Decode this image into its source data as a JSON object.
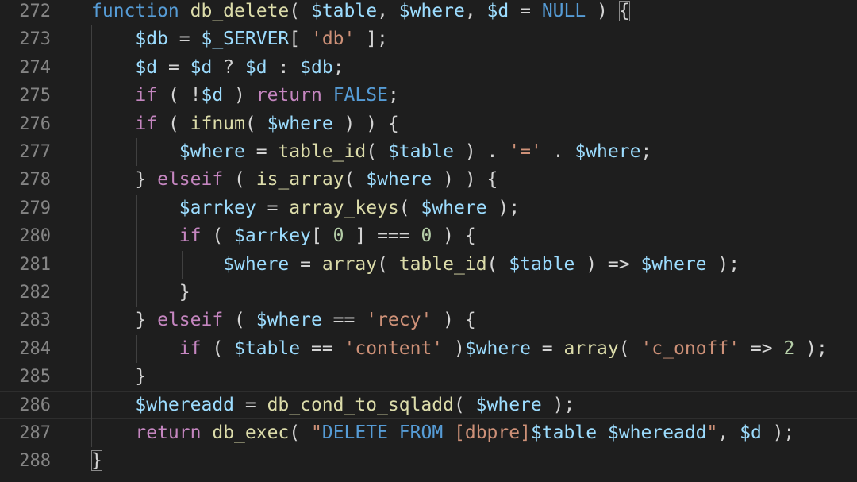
{
  "editor": {
    "language": "php",
    "colors": {
      "background": "#1e1e1e",
      "line_number": "#858585",
      "keyword": "#569cd6",
      "control": "#c586c0",
      "function": "#dcdcaa",
      "variable": "#9cdcfe",
      "string": "#ce9178",
      "number": "#b5cea8"
    },
    "lines": [
      {
        "number": "272",
        "tokens": [
          {
            "t": "function",
            "c": "k-fn"
          },
          {
            "t": " "
          },
          {
            "t": "db_delete",
            "c": "fn"
          },
          {
            "t": "( "
          },
          {
            "t": "$table",
            "c": "v"
          },
          {
            "t": ", "
          },
          {
            "t": "$where",
            "c": "v"
          },
          {
            "t": ", "
          },
          {
            "t": "$d",
            "c": "v"
          },
          {
            "t": " = "
          },
          {
            "t": "NULL",
            "c": "c"
          },
          {
            "t": " ) "
          },
          {
            "t": "{",
            "c": "bracket-hl"
          }
        ]
      },
      {
        "number": "273",
        "tokens": [
          {
            "t": "    "
          },
          {
            "t": "$db",
            "c": "v"
          },
          {
            "t": " = "
          },
          {
            "t": "$_SERVER",
            "c": "v"
          },
          {
            "t": "[ "
          },
          {
            "t": "'db'",
            "c": "s"
          },
          {
            "t": " ];"
          }
        ]
      },
      {
        "number": "274",
        "tokens": [
          {
            "t": "    "
          },
          {
            "t": "$d",
            "c": "v"
          },
          {
            "t": " = "
          },
          {
            "t": "$d",
            "c": "v"
          },
          {
            "t": " ? "
          },
          {
            "t": "$d",
            "c": "v"
          },
          {
            "t": " : "
          },
          {
            "t": "$db",
            "c": "v"
          },
          {
            "t": ";"
          }
        ]
      },
      {
        "number": "275",
        "tokens": [
          {
            "t": "    "
          },
          {
            "t": "if",
            "c": "k-ctl"
          },
          {
            "t": " ( !"
          },
          {
            "t": "$d",
            "c": "v"
          },
          {
            "t": " ) "
          },
          {
            "t": "return",
            "c": "k-ctl"
          },
          {
            "t": " "
          },
          {
            "t": "FALSE",
            "c": "c"
          },
          {
            "t": ";"
          }
        ]
      },
      {
        "number": "276",
        "tokens": [
          {
            "t": "    "
          },
          {
            "t": "if",
            "c": "k-ctl"
          },
          {
            "t": " ( "
          },
          {
            "t": "ifnum",
            "c": "fn"
          },
          {
            "t": "( "
          },
          {
            "t": "$where",
            "c": "v"
          },
          {
            "t": " ) ) {"
          }
        ]
      },
      {
        "number": "277",
        "tokens": [
          {
            "t": "        "
          },
          {
            "t": "$where",
            "c": "v"
          },
          {
            "t": " = "
          },
          {
            "t": "table_id",
            "c": "fn"
          },
          {
            "t": "( "
          },
          {
            "t": "$table",
            "c": "v"
          },
          {
            "t": " ) . "
          },
          {
            "t": "'='",
            "c": "s"
          },
          {
            "t": " . "
          },
          {
            "t": "$where",
            "c": "v"
          },
          {
            "t": ";"
          }
        ]
      },
      {
        "number": "278",
        "tokens": [
          {
            "t": "    } "
          },
          {
            "t": "elseif",
            "c": "k-ctl"
          },
          {
            "t": " ( "
          },
          {
            "t": "is_array",
            "c": "fn"
          },
          {
            "t": "( "
          },
          {
            "t": "$where",
            "c": "v"
          },
          {
            "t": " ) ) {"
          }
        ]
      },
      {
        "number": "279",
        "tokens": [
          {
            "t": "        "
          },
          {
            "t": "$arrkey",
            "c": "v"
          },
          {
            "t": " = "
          },
          {
            "t": "array_keys",
            "c": "fn"
          },
          {
            "t": "( "
          },
          {
            "t": "$where",
            "c": "v"
          },
          {
            "t": " );"
          }
        ]
      },
      {
        "number": "280",
        "tokens": [
          {
            "t": "        "
          },
          {
            "t": "if",
            "c": "k-ctl"
          },
          {
            "t": " ( "
          },
          {
            "t": "$arrkey",
            "c": "v"
          },
          {
            "t": "[ "
          },
          {
            "t": "0",
            "c": "n"
          },
          {
            "t": " ] === "
          },
          {
            "t": "0",
            "c": "n"
          },
          {
            "t": " ) {"
          }
        ]
      },
      {
        "number": "281",
        "tokens": [
          {
            "t": "            "
          },
          {
            "t": "$where",
            "c": "v"
          },
          {
            "t": " = "
          },
          {
            "t": "array",
            "c": "fn"
          },
          {
            "t": "( "
          },
          {
            "t": "table_id",
            "c": "fn"
          },
          {
            "t": "( "
          },
          {
            "t": "$table",
            "c": "v"
          },
          {
            "t": " ) => "
          },
          {
            "t": "$where",
            "c": "v"
          },
          {
            "t": " );"
          }
        ]
      },
      {
        "number": "282",
        "tokens": [
          {
            "t": "        }"
          }
        ]
      },
      {
        "number": "283",
        "tokens": [
          {
            "t": "    } "
          },
          {
            "t": "elseif",
            "c": "k-ctl"
          },
          {
            "t": " ( "
          },
          {
            "t": "$where",
            "c": "v"
          },
          {
            "t": " == "
          },
          {
            "t": "'recy'",
            "c": "s"
          },
          {
            "t": " ) {"
          }
        ]
      },
      {
        "number": "284",
        "tokens": [
          {
            "t": "        "
          },
          {
            "t": "if",
            "c": "k-ctl"
          },
          {
            "t": " ( "
          },
          {
            "t": "$table",
            "c": "v"
          },
          {
            "t": " == "
          },
          {
            "t": "'content'",
            "c": "s"
          },
          {
            "t": " )"
          },
          {
            "t": "$where",
            "c": "v"
          },
          {
            "t": " = "
          },
          {
            "t": "array",
            "c": "fn"
          },
          {
            "t": "( "
          },
          {
            "t": "'c_onoff'",
            "c": "s"
          },
          {
            "t": " => "
          },
          {
            "t": "2",
            "c": "n"
          },
          {
            "t": " );"
          }
        ]
      },
      {
        "number": "285",
        "tokens": [
          {
            "t": "    }"
          }
        ]
      },
      {
        "number": "286",
        "current": true,
        "tokens": [
          {
            "t": "    "
          },
          {
            "t": "$whereadd",
            "c": "v"
          },
          {
            "t": " = "
          },
          {
            "t": "db_cond_to_sqladd",
            "c": "fn"
          },
          {
            "t": "( "
          },
          {
            "t": "$where",
            "c": "v"
          },
          {
            "t": " );"
          }
        ]
      },
      {
        "number": "287",
        "tokens": [
          {
            "t": "    "
          },
          {
            "t": "return",
            "c": "k-ctl"
          },
          {
            "t": " "
          },
          {
            "t": "db_exec",
            "c": "fn"
          },
          {
            "t": "( "
          },
          {
            "t": "\"",
            "c": "s"
          },
          {
            "t": "DELETE FROM",
            "c": "k-fn"
          },
          {
            "t": " [dbpre]",
            "c": "s"
          },
          {
            "t": "$table",
            "c": "v"
          },
          {
            "t": " ",
            "c": "s"
          },
          {
            "t": "$whereadd",
            "c": "v"
          },
          {
            "t": "\"",
            "c": "s"
          },
          {
            "t": ", "
          },
          {
            "t": "$d",
            "c": "v"
          },
          {
            "t": " );"
          }
        ]
      },
      {
        "number": "288",
        "tokens": [
          {
            "t": "}",
            "c": "bracket-hl"
          }
        ]
      }
    ]
  }
}
